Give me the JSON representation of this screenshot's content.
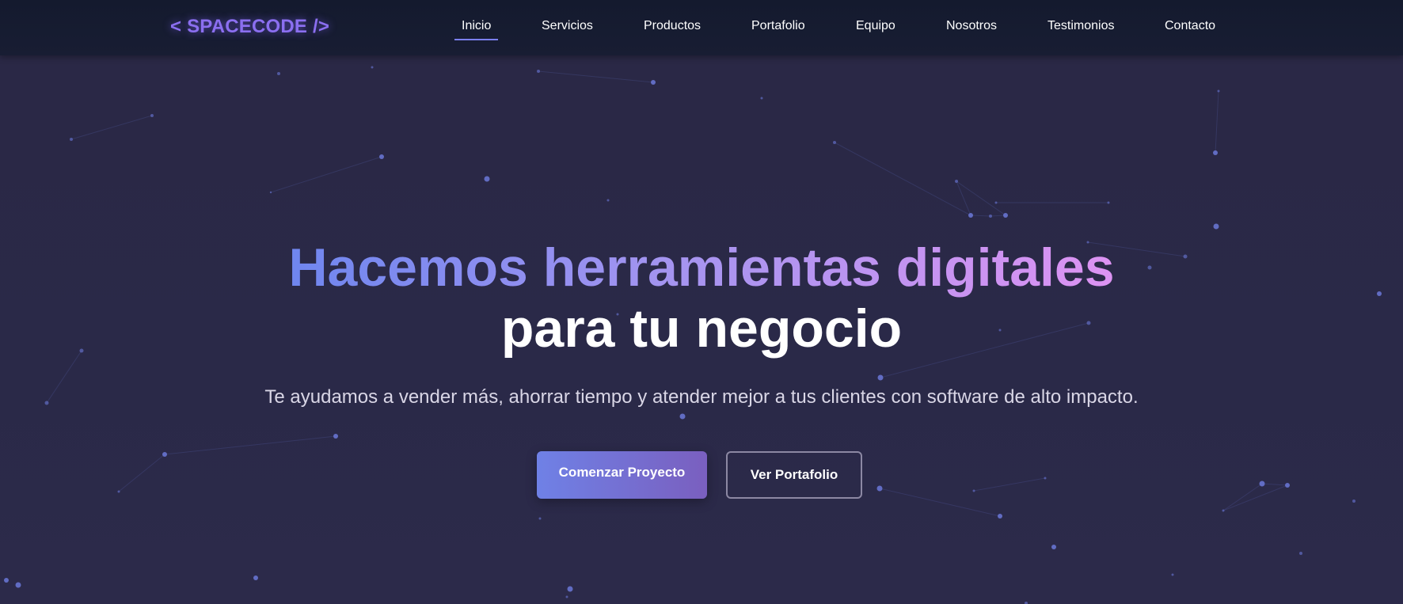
{
  "brand": {
    "logo_text": "< SPACECODE />",
    "accent_color": "#8b6ff0"
  },
  "nav": {
    "items": [
      {
        "label": "Inicio",
        "active": true
      },
      {
        "label": "Servicios",
        "active": false
      },
      {
        "label": "Productos",
        "active": false
      },
      {
        "label": "Portafolio",
        "active": false
      },
      {
        "label": "Equipo",
        "active": false
      },
      {
        "label": "Nosotros",
        "active": false
      },
      {
        "label": "Testimonios",
        "active": false
      },
      {
        "label": "Contacto",
        "active": false
      }
    ]
  },
  "hero": {
    "title_highlight": "Hacemos herramientas digitales",
    "title_rest": "para tu negocio",
    "subtitle": "Te ayudamos a vender más, ahorrar tiempo y atender mejor a tus clientes con software de alto impacto.",
    "primary_button": "Comenzar Proyecto",
    "secondary_button": "Ver Portafolio"
  },
  "colors": {
    "background": "#2a2845",
    "navbar": "#151a2f",
    "gradient_start": "#6f86ef",
    "gradient_end": "#dd93f2",
    "particle": "#6b78d8"
  }
}
